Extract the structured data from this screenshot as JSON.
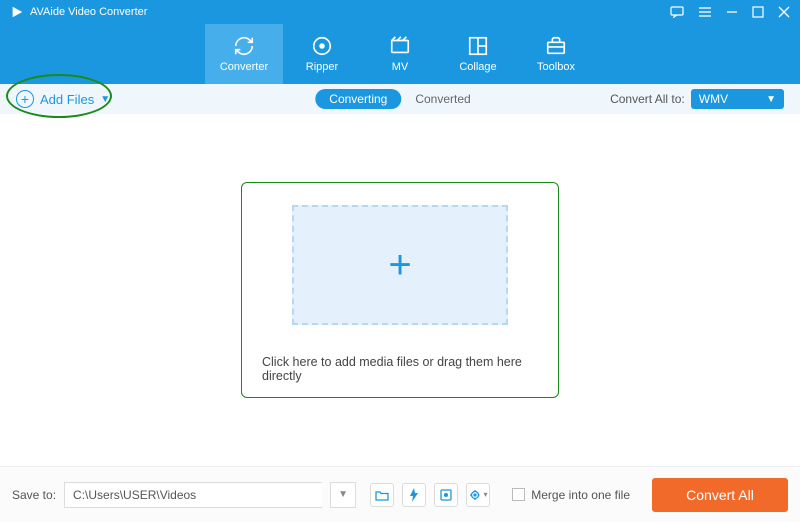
{
  "app": {
    "title": "AVAide Video Converter"
  },
  "nav": {
    "items": [
      {
        "label": "Converter"
      },
      {
        "label": "Ripper"
      },
      {
        "label": "MV"
      },
      {
        "label": "Collage"
      },
      {
        "label": "Toolbox"
      }
    ]
  },
  "subbar": {
    "add_files": "Add Files",
    "tabs": {
      "converting": "Converting",
      "converted": "Converted"
    },
    "convert_all_to_label": "Convert All to:",
    "selected_format": "WMV"
  },
  "main": {
    "drop_text": "Click here to add media files or drag them here directly"
  },
  "footer": {
    "save_to_label": "Save to:",
    "path": "C:\\Users\\USER\\Videos",
    "merge_label": "Merge into one file",
    "convert_button": "Convert All"
  }
}
